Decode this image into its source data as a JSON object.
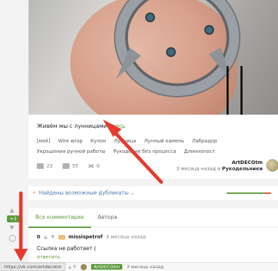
{
  "post": {
    "text": "Живём мы с лунницами",
    "link": "здесь",
    "tags": [
      "[моё]",
      "Wire wrap",
      "Кулон",
      "Лунница",
      "Лунный камень",
      "Лабрадор",
      "Украшения ручной работы",
      "Рукоделие без процесса",
      "Длиннопост"
    ],
    "stats": {
      "comments": "22",
      "saves": "55",
      "shares": "0"
    },
    "author": "ArtDECOtm",
    "meta_time": "3 месяца назад",
    "meta_in": "в",
    "meta_community": "Рукодельники"
  },
  "duplicates": {
    "label": "Найдены возможные дубликаты",
    "chevron": "⌄"
  },
  "vote": {
    "up_arrow": "▲",
    "rating": "+1",
    "down_arrow": "▼"
  },
  "comments": {
    "tabs": [
      "Все комментарии",
      "Автора"
    ],
    "items": [
      {
        "score": "0",
        "user": "missispetrof",
        "time": "3 месяца назад",
        "body": "Ссылка не работает (",
        "reply": "ответить"
      }
    ]
  },
  "statusbar": {
    "url": "https://vk.com/artdecotm",
    "badge": "ArtDECOtm",
    "time": "3 месяца назад"
  },
  "colors": {
    "accent": "#5b9a3a",
    "link": "#4a7fb0",
    "arrow": "#e53a2f"
  }
}
